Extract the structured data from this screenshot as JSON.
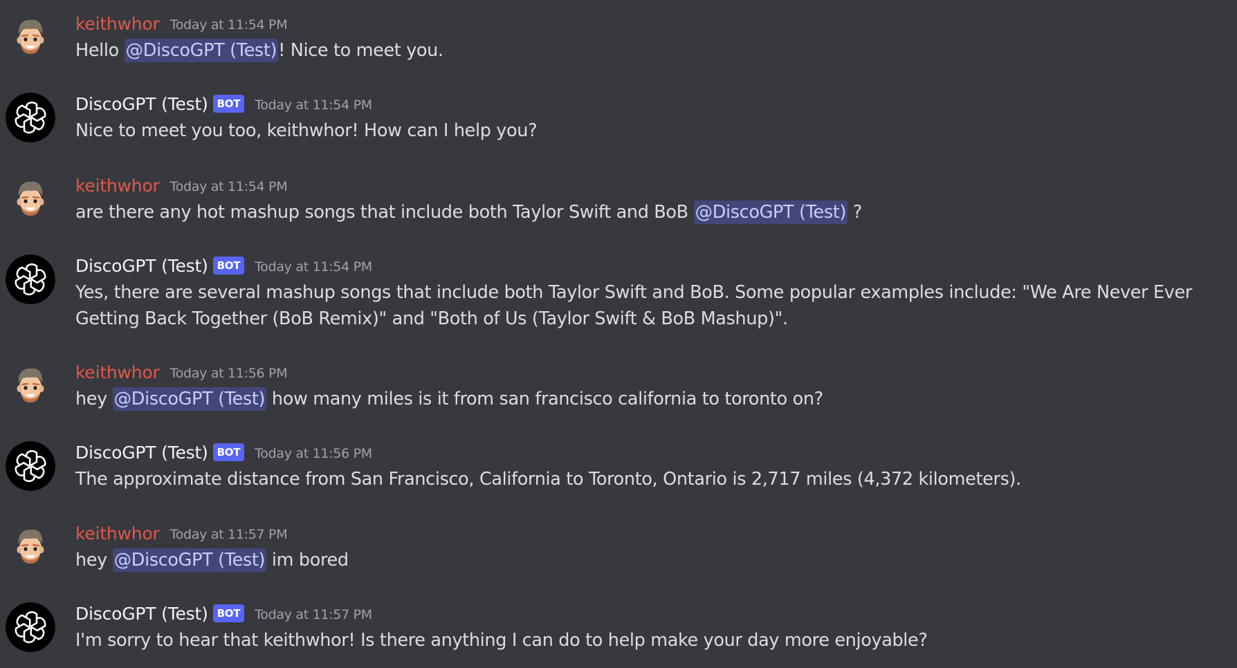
{
  "channel": {
    "messages": [
      {
        "author": "keithwhor",
        "author_type": "user",
        "avatar_icon": "memoji-avatar-icon",
        "timestamp": "Today at 11:54 PM",
        "parts": [
          {
            "type": "text",
            "text": "Hello "
          },
          {
            "type": "mention",
            "text": "@DiscoGPT (Test)"
          },
          {
            "type": "text",
            "text": "! Nice to meet you."
          }
        ]
      },
      {
        "author": "DiscoGPT (Test)",
        "author_type": "bot",
        "badge": "BOT",
        "avatar_icon": "openai-logo-icon",
        "timestamp": "Today at 11:54 PM",
        "parts": [
          {
            "type": "text",
            "text": "Nice to meet you too, keithwhor! How can I help you?"
          }
        ]
      },
      {
        "author": "keithwhor",
        "author_type": "user",
        "avatar_icon": "memoji-avatar-icon",
        "timestamp": "Today at 11:54 PM",
        "parts": [
          {
            "type": "text",
            "text": "are there any hot mashup songs that include both Taylor Swift and BoB "
          },
          {
            "type": "mention",
            "text": "@DiscoGPT (Test)"
          },
          {
            "type": "text",
            "text": " ?"
          }
        ]
      },
      {
        "author": "DiscoGPT (Test)",
        "author_type": "bot",
        "badge": "BOT",
        "avatar_icon": "openai-logo-icon",
        "timestamp": "Today at 11:54 PM",
        "parts": [
          {
            "type": "text",
            "text": "Yes, there are several mashup songs that include both Taylor Swift and BoB. Some popular examples include: \"We Are Never Ever Getting Back Together (BoB Remix)\" and \"Both of Us (Taylor Swift & BoB Mashup)\"."
          }
        ]
      },
      {
        "author": "keithwhor",
        "author_type": "user",
        "avatar_icon": "memoji-avatar-icon",
        "timestamp": "Today at 11:56 PM",
        "parts": [
          {
            "type": "text",
            "text": "hey "
          },
          {
            "type": "mention",
            "text": "@DiscoGPT (Test)"
          },
          {
            "type": "text",
            "text": " how many miles is it from san francisco california to toronto on?"
          }
        ]
      },
      {
        "author": "DiscoGPT (Test)",
        "author_type": "bot",
        "badge": "BOT",
        "avatar_icon": "openai-logo-icon",
        "timestamp": "Today at 11:56 PM",
        "parts": [
          {
            "type": "text",
            "text": "The approximate distance from San Francisco, California to Toronto, Ontario is 2,717 miles (4,372 kilometers)."
          }
        ]
      },
      {
        "author": "keithwhor",
        "author_type": "user",
        "avatar_icon": "memoji-avatar-icon",
        "timestamp": "Today at 11:57 PM",
        "parts": [
          {
            "type": "text",
            "text": "hey "
          },
          {
            "type": "mention",
            "text": "@DiscoGPT (Test)"
          },
          {
            "type": "text",
            "text": " im bored"
          }
        ]
      },
      {
        "author": "DiscoGPT (Test)",
        "author_type": "bot",
        "badge": "BOT",
        "avatar_icon": "openai-logo-icon",
        "timestamp": "Today at 11:57 PM",
        "parts": [
          {
            "type": "text",
            "text": "I'm sorry to hear that keithwhor! Is there anything I can do to help make your day more enjoyable?"
          }
        ]
      }
    ]
  },
  "colors": {
    "background": "#38393e",
    "user_name": "#e0584b",
    "bot_name": "#f2f3f5",
    "bot_badge": "#5865f2",
    "mention_bg": "#43467a",
    "mention_text": "#c9cdfb",
    "timestamp": "#a0a3a9",
    "message_text": "#dbdee1"
  }
}
